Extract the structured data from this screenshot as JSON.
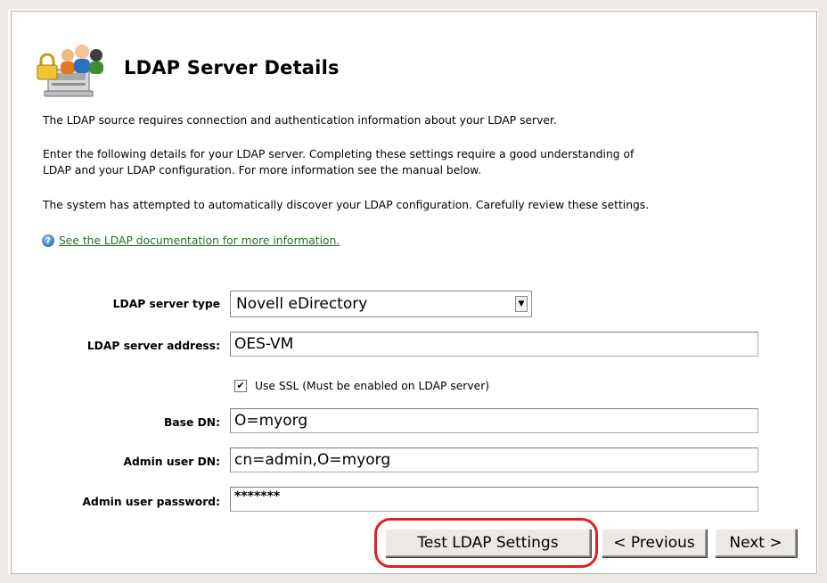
{
  "page": {
    "title": "LDAP Server Details",
    "paragraph1": "The LDAP source requires connection and authentication information about your LDAP server.",
    "paragraph2_line1": "Enter the following details for your LDAP server. Completing these settings require a good understanding of",
    "paragraph2_line2": "LDAP and your LDAP configuration. For more information see the manual below.",
    "paragraph3": "The system has attempted to automatically discover your LDAP configuration. Carefully review these settings.",
    "help_link": "See the LDAP documentation for more information."
  },
  "form": {
    "server_type_label": "LDAP server type",
    "server_type_value": "Novell eDirectory",
    "server_address_label": "LDAP server address:",
    "server_address_value": "OES-VM",
    "use_ssl_label": "Use SSL (Must be enabled on LDAP server)",
    "use_ssl_checked": true,
    "base_dn_label": "Base DN:",
    "base_dn_value": "O=myorg",
    "admin_dn_label": "Admin user DN:",
    "admin_dn_value": "cn=admin,O=myorg",
    "admin_password_label": "Admin user password:",
    "admin_password_value": "*******"
  },
  "buttons": {
    "test": "Test LDAP Settings",
    "previous": "< Previous",
    "next": "Next >"
  },
  "icons": {
    "header": "users-lock-server-icon",
    "help": "help-icon",
    "dropdown": "dropdown-arrow-icon",
    "checkmark": "checkmark-icon"
  },
  "colors": {
    "highlight": "#e02020",
    "link": "#2a6a2a"
  }
}
